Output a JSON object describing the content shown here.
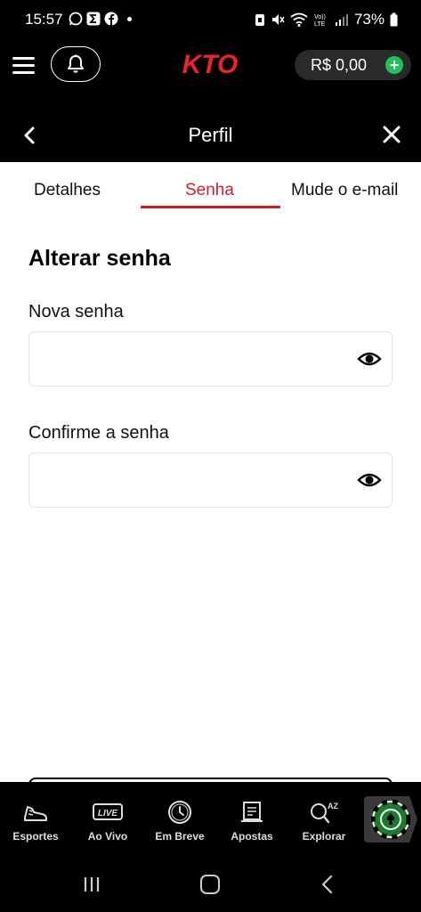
{
  "status_bar": {
    "time": "15:57",
    "battery": "73%",
    "icons_left": [
      "whatsapp-icon",
      "sigma-icon",
      "facebook-icon"
    ],
    "icons_right": [
      "nfc-icon",
      "mute-icon",
      "wifi-icon",
      "volte-icon",
      "signal-icon",
      "battery-icon"
    ]
  },
  "header": {
    "logo": "KTO",
    "balance": "R$ 0,00",
    "add_symbol": "+",
    "colors": {
      "logo": "#e8232a",
      "add": "#1fc15b"
    }
  },
  "subheader": {
    "title": "Perfil"
  },
  "tabs": [
    {
      "label": "Detalhes",
      "active": false
    },
    {
      "label": "Senha",
      "active": true
    },
    {
      "label": "Mude o e-mail",
      "active": false
    }
  ],
  "form": {
    "title": "Alterar senha",
    "new_password": {
      "label": "Nova senha",
      "value": ""
    },
    "confirm_password": {
      "label": "Confirme a senha",
      "value": ""
    }
  },
  "bottom_nav": {
    "items": [
      {
        "label": "Esportes",
        "icon": "shoe-icon"
      },
      {
        "label": "Ao Vivo",
        "icon": "live-icon",
        "icon_text": "LIVE"
      },
      {
        "label": "Em Breve",
        "icon": "clock-icon"
      },
      {
        "label": "Apostas",
        "icon": "betslip-icon"
      },
      {
        "label": "Explorar",
        "icon": "search-az-icon",
        "icon_text": "AZ"
      }
    ],
    "casino": {
      "icon": "casino-chip-icon"
    }
  },
  "colors": {
    "accent_red": "#d0202a",
    "background_dark": "#000000",
    "field_border": "#e2e2e2"
  }
}
